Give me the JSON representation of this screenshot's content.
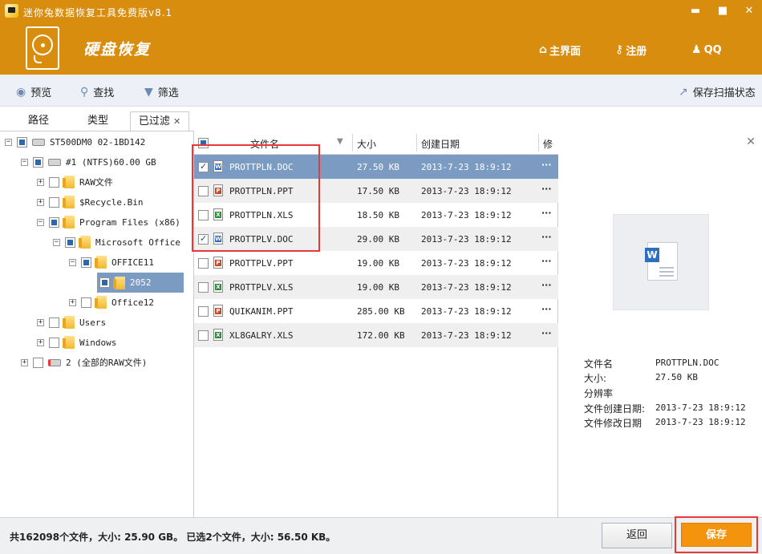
{
  "window": {
    "title": "迷你兔数据恢复工具免费版v8.1",
    "min": "▬",
    "max": "■",
    "close": "✕"
  },
  "header": {
    "heading": "硬盘恢复",
    "nav": [
      {
        "label": "主界面",
        "icon": "home-icon",
        "glyph": "⌂"
      },
      {
        "label": "注册",
        "icon": "key-icon",
        "glyph": "⚷"
      },
      {
        "label": "QQ",
        "icon": "qq-penguin-icon",
        "glyph": "♟"
      }
    ]
  },
  "toolbar": {
    "preview": "预览",
    "find": "查找",
    "filter": "筛选",
    "save_scan": "保存扫描状态"
  },
  "tabs": {
    "path": "路径",
    "type": "类型",
    "filtered": "已过滤",
    "close": "✕"
  },
  "tree": [
    {
      "label": "ST500DM0 02-1BD142"
    },
    {
      "label": "#1 (NTFS)60.00 GB"
    },
    {
      "label": "RAW文件"
    },
    {
      "label": "$Recycle.Bin"
    },
    {
      "label": "Program Files (x86)"
    },
    {
      "label": "Microsoft Office"
    },
    {
      "label": "OFFICE11"
    },
    {
      "label": "2052"
    },
    {
      "label": "Office12"
    },
    {
      "label": "Users"
    },
    {
      "label": "Windows"
    },
    {
      "label": "2  (全部的RAW文件)"
    }
  ],
  "list": {
    "headers": {
      "name": "文件名",
      "size": "大小",
      "date": "创建日期",
      "modified": "修"
    },
    "rows": [
      {
        "name": "PROTTPLN.DOC",
        "size": "27.50 KB",
        "date": "2013-7-23 18:9:12",
        "type": "doc",
        "checked": true,
        "selected": true
      },
      {
        "name": "PROTTPLN.PPT",
        "size": "17.50 KB",
        "date": "2013-7-23 18:9:12",
        "type": "ppt",
        "checked": false
      },
      {
        "name": "PROTTPLN.XLS",
        "size": "18.50 KB",
        "date": "2013-7-23 18:9:12",
        "type": "xls",
        "checked": false
      },
      {
        "name": "PROTTPLV.DOC",
        "size": "29.00 KB",
        "date": "2013-7-23 18:9:12",
        "type": "doc",
        "checked": true
      },
      {
        "name": "PROTTPLV.PPT",
        "size": "19.00 KB",
        "date": "2013-7-23 18:9:12",
        "type": "ppt",
        "checked": false
      },
      {
        "name": "PROTTPLV.XLS",
        "size": "19.00 KB",
        "date": "2013-7-23 18:9:12",
        "type": "xls",
        "checked": false
      },
      {
        "name": "QUIKANIM.PPT",
        "size": "285.00 KB",
        "date": "2013-7-23 18:9:12",
        "type": "ppt",
        "checked": false
      },
      {
        "name": "XL8GALRY.XLS",
        "size": "172.00 KB",
        "date": "2013-7-23 18:9:12",
        "type": "xls",
        "checked": false
      }
    ],
    "more": "···"
  },
  "preview": {
    "close": "✕",
    "labels": {
      "name": "文件名",
      "size": "大小:",
      "resolution": "分辨率",
      "created": "文件创建日期:",
      "modified": "文件修改日期"
    },
    "values": {
      "name": "PROTTPLN.DOC",
      "size": "27.50 KB",
      "created": "2013-7-23 18:9:12",
      "modified": "2013-7-23 18:9:12"
    }
  },
  "status": {
    "text": "共162098个文件，大小: 25.90 GB。 已选2个文件，大小: 56.50 KB。"
  },
  "buttons": {
    "back": "返回",
    "save": "保存"
  }
}
